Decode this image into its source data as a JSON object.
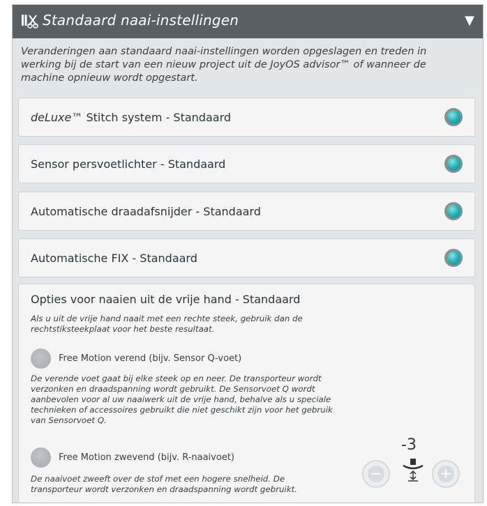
{
  "header": {
    "title": "Standaard naai-instellingen",
    "collapse_icon": "triangle-down-icon",
    "icon": "sewing-tools-icon"
  },
  "intro": "Veranderingen aan standaard naai-instellingen worden opgeslagen en treden in werking bij de start van een nieuw project uit de JoyOS advisor™ of wanneer de machine opnieuw wordt opgestart.",
  "settings": [
    {
      "label_italic": "deLuxe",
      "label": "™ Stitch system - Standaard",
      "state": "on"
    },
    {
      "label_italic": "",
      "label": "Sensor persvoetlichter - Standaard",
      "state": "on"
    },
    {
      "label_italic": "",
      "label": "Automatische draadafsnijder - Standaard",
      "state": "on"
    },
    {
      "label_italic": "",
      "label": "Automatische FIX - Standaard",
      "state": "on"
    }
  ],
  "free_motion": {
    "title": "Opties voor naaien uit de vrije hand - Standaard",
    "note": "Als u uit de vrije hand naait met een rechte steek, gebruik dan de rechtstiksteekplaat voor het beste resultaat.",
    "option1": {
      "label": "Free Motion verend (bijv. Sensor Q-voet)",
      "description": "De verende voet gaat bij elke steek op en neer. De transporteur wordt verzonken en draadspanning wordt gebruikt. De Sensorvoet Q wordt aanbevolen voor al uw naaiwerk uit de vrije hand, behalve als u speciale technieken of accessoires gebruikt die niet geschikt zijn voor het gebruik van Sensorvoet Q.",
      "selected": false
    },
    "option2": {
      "label": "Free Motion zwevend (bijv. R-naaivoet)",
      "description": "De naaivoet zweeft over de stof met een hogere snelheid. De transporteur wordt verzonken en draadspanning wordt gebruikt.",
      "selected": false
    },
    "stepper": {
      "value": "-3",
      "minus_icon": "minus-icon",
      "plus_icon": "plus-icon",
      "foot_icon": "presser-foot-height-icon"
    }
  },
  "colors": {
    "header_bg": "#5a5f64",
    "led_on": "#2fb3b8",
    "panel_bg": "#e4e5e6"
  }
}
